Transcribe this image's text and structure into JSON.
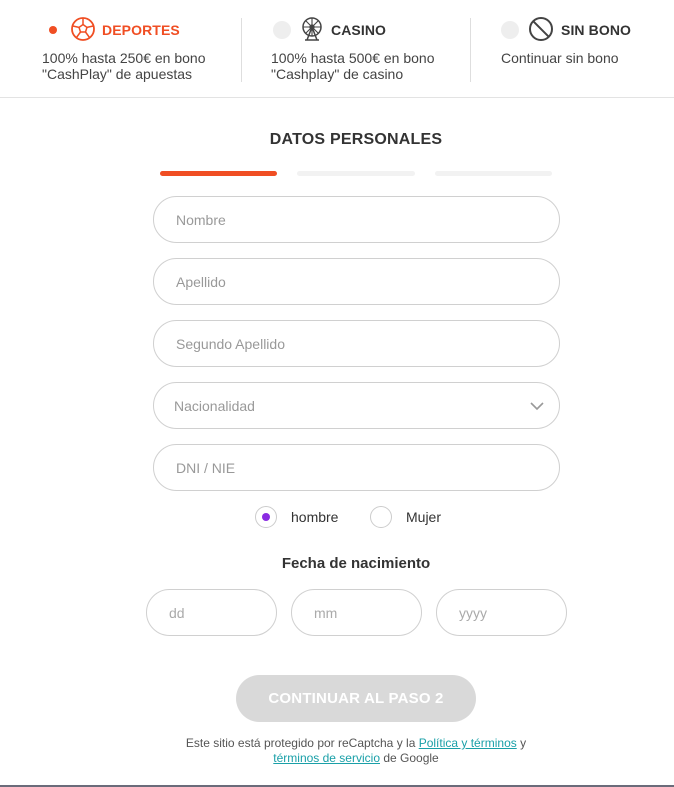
{
  "bonus_options": {
    "deportes": {
      "title": "DEPORTES",
      "desc_line1": "100% hasta 250€ en bono",
      "desc_line2": "\"CashPlay\" de apuestas",
      "icon": "soccer-ball-icon",
      "selected": true
    },
    "casino": {
      "title": "CASINO",
      "desc_line1": "100% hasta 500€ en bono",
      "desc_line2": "\"Cashplay\" de casino",
      "icon": "ferris-wheel-icon",
      "selected": false
    },
    "sin_bono": {
      "title": "SIN BONO",
      "desc_line1": "Continuar sin bono",
      "icon": "prohibited-icon",
      "selected": false
    }
  },
  "form": {
    "section_title": "DATOS PERSONALES",
    "steps": {
      "current": 1,
      "total": 3
    },
    "fields": {
      "nombre": {
        "placeholder": "Nombre",
        "value": ""
      },
      "apellido": {
        "placeholder": "Apellido",
        "value": ""
      },
      "segundo_apellido": {
        "placeholder": "Segundo Apellido",
        "value": ""
      },
      "nacionalidad": {
        "selected": "Nacionalidad"
      },
      "dni": {
        "placeholder": "DNI / NIE",
        "value": ""
      }
    },
    "gender": {
      "options": [
        {
          "label": "hombre",
          "checked": true
        },
        {
          "label": "Mujer",
          "checked": false
        }
      ]
    },
    "birth_date": {
      "title": "Fecha de nacimiento",
      "day_placeholder": "dd",
      "month_placeholder": "mm",
      "year_placeholder": "yyyy"
    },
    "continue_label": "CONTINUAR AL PASO 2"
  },
  "recaptcha": {
    "text_before": "Este sitio está protegido por reCaptcha y la ",
    "policy_link": "Política y términos",
    "text_middle": " y",
    "terms_link": "términos de servicio",
    "text_after": " de Google"
  },
  "colors": {
    "accent": "#f04e23",
    "radio_checked": "#8a2be2",
    "link": "#1aa0a8",
    "button_disabled": "#d9d9d9"
  }
}
